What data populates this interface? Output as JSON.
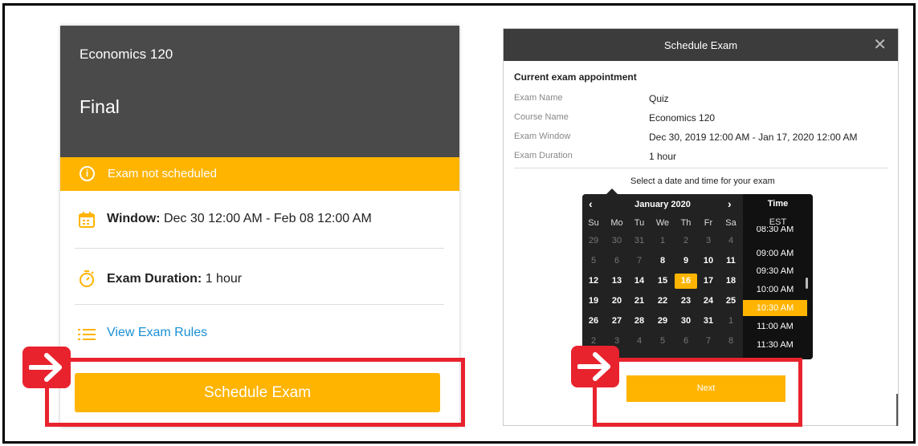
{
  "card": {
    "course": "Economics 120",
    "exam": "Final",
    "status": "Exam not scheduled",
    "status_icon": "info-icon",
    "window_label": "Window:",
    "window_value": " Dec 30 12:00 AM - Feb 08 12:00 AM",
    "duration_label": "Exam Duration:",
    "duration_value": " 1 hour",
    "rules_link": "View Exam Rules",
    "schedule_button": "Schedule Exam"
  },
  "modal": {
    "title": "Schedule Exam",
    "close": "✕",
    "appointment_heading": "Current exam appointment",
    "fields": [
      {
        "label": "Exam Name",
        "value": "Quiz"
      },
      {
        "label": "Course Name",
        "value": "Economics 120"
      },
      {
        "label": "Exam Window",
        "value": "Dec 30, 2019 12:00 AM - Jan 17, 2020 12:00 AM"
      },
      {
        "label": "Exam Duration",
        "value": "1 hour"
      }
    ],
    "prompt": "Select a date and time for your exam",
    "next_button": "Next"
  },
  "calendar": {
    "month": "January 2020",
    "prev": "‹",
    "next": "›",
    "weekdays": [
      "Su",
      "Mo",
      "Tu",
      "We",
      "Th",
      "Fr",
      "Sa"
    ],
    "weeks": [
      [
        "29",
        "30",
        "31",
        "1",
        "2",
        "3",
        "4"
      ],
      [
        "5",
        "6",
        "7",
        "8",
        "9",
        "10",
        "11"
      ],
      [
        "12",
        "13",
        "14",
        "15",
        "16",
        "17",
        "18"
      ],
      [
        "19",
        "20",
        "21",
        "22",
        "23",
        "24",
        "25"
      ],
      [
        "26",
        "27",
        "28",
        "29",
        "30",
        "31",
        "1"
      ],
      [
        "2",
        "3",
        "4",
        "5",
        "6",
        "7",
        "8"
      ]
    ],
    "selected_day": "16",
    "time_heading": "Time",
    "timezone": "EST",
    "times": [
      "08:30 AM",
      "09:00 AM",
      "09:30 AM",
      "10:00 AM",
      "10:30 AM",
      "11:00 AM",
      "11:30 AM"
    ],
    "selected_time": "10:30 AM"
  },
  "annotations": {
    "highlight_color": "#e8232e",
    "arrow_icon": "arrow-right-icon"
  },
  "colors": {
    "accent": "#ffb400",
    "header": "#4a4a4a",
    "modal_header": "#3c3c3c",
    "link": "#1a90d6"
  }
}
